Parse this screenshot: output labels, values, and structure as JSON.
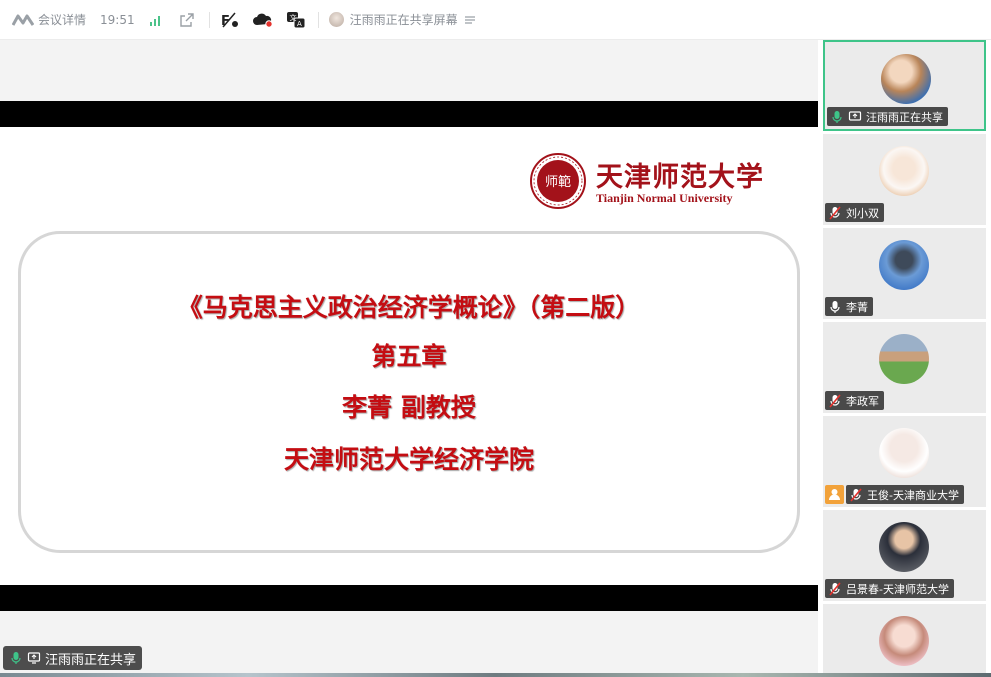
{
  "topbar": {
    "meeting_details_label": "会议详情",
    "time": "19:51",
    "sharing_status": "汪雨雨正在共享屏幕"
  },
  "slide": {
    "university_cn": "天津师范大学",
    "university_en": "Tianjin Normal University",
    "seal_text": "师範",
    "course_title": "《马克思主义政治经济学概论》（第二版）",
    "chapter": "第五章",
    "lecturer": "李菁 副教授",
    "school": "天津师范大学经济学院"
  },
  "stage": {
    "sharer_label": "汪雨雨正在共享"
  },
  "participants": [
    {
      "name": "汪雨雨正在共享",
      "mic": "on",
      "sharing": true,
      "active": true
    },
    {
      "name": "刘小双",
      "mic": "muted"
    },
    {
      "name": "李菁",
      "mic": "on"
    },
    {
      "name": "李政军",
      "mic": "muted"
    },
    {
      "name": "王俊-天津商业大学",
      "mic": "muted",
      "host": true
    },
    {
      "name": "吕景春-天津师范大学",
      "mic": "muted"
    },
    {
      "name": "",
      "mic": "muted"
    }
  ],
  "colors": {
    "accent_green": "#3ec489",
    "slide_red": "#c40d12",
    "host_orange": "#f2a23a"
  }
}
